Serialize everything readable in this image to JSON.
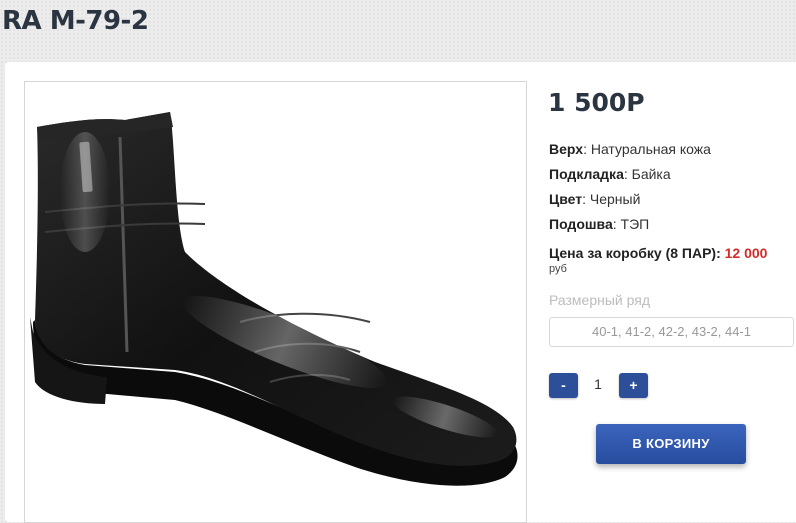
{
  "product": {
    "title": "RA M-79-2",
    "price": "1 500Р",
    "specs": [
      {
        "label": "Верх",
        "value": "Натуральная кожа"
      },
      {
        "label": "Подкладка",
        "value": "Байка"
      },
      {
        "label": "Цвет",
        "value": "Черный"
      },
      {
        "label": "Подошва",
        "value": "ТЭП"
      }
    ],
    "box_price_label": "Цена за коробку (8 ПАР):",
    "box_price_value": "12 000",
    "currency": "руб",
    "size_label": "Размерный ряд",
    "size_value": "40-1, 41-2, 42-2, 43-2, 44-1",
    "image_alt": "black leather ankle boot with side zipper"
  },
  "quantity": {
    "minus_label": "-",
    "value": "1",
    "plus_label": "+"
  },
  "cart_button_label": "В КОРЗИНУ",
  "colors": {
    "accent_blue": "#2d4f9a",
    "price_red": "#d42a2a",
    "title_dark": "#2b3441"
  }
}
